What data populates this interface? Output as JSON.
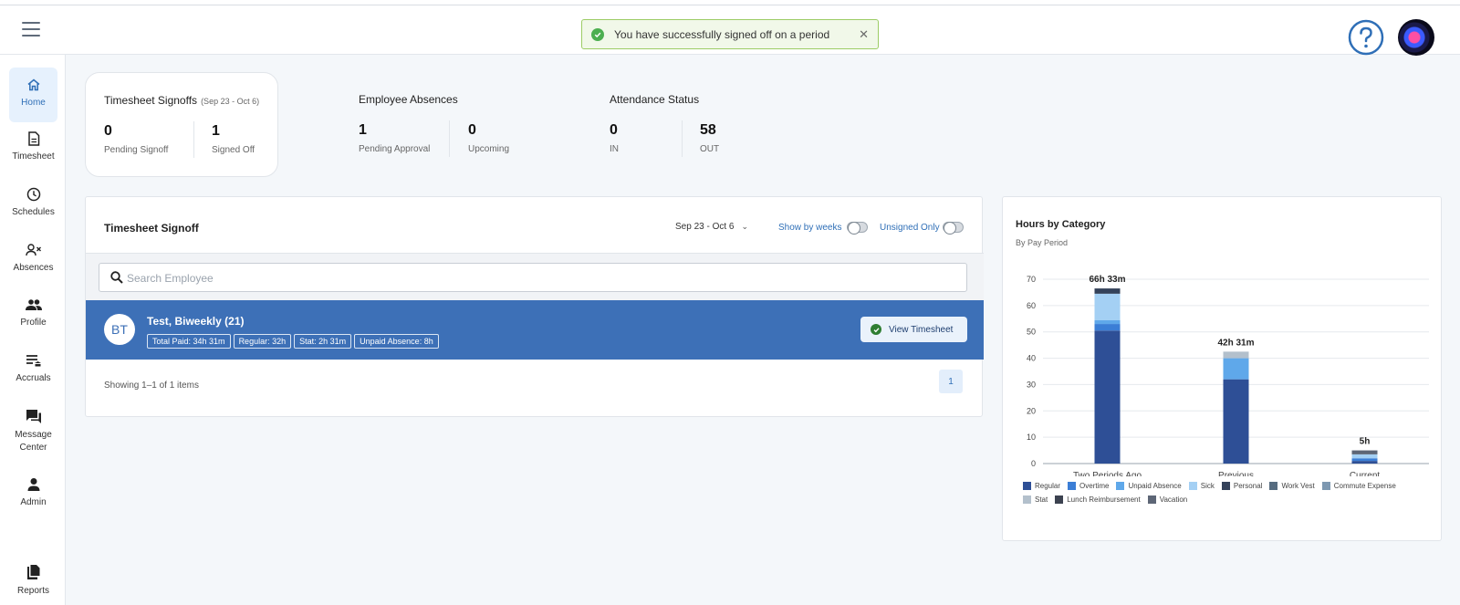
{
  "toast": {
    "message": "You have successfully signed off on a period"
  },
  "nav": {
    "items": [
      {
        "label": "Home",
        "icon": "home-icon"
      },
      {
        "label": "Timesheet",
        "icon": "document-icon"
      },
      {
        "label": "Schedules",
        "icon": "clock-icon"
      },
      {
        "label": "Absences",
        "icon": "person-remove-icon"
      },
      {
        "label": "Profile",
        "icon": "people-icon"
      },
      {
        "label": "Accruals",
        "icon": "list-bank-icon"
      },
      {
        "label": "Message Center",
        "icon": "chat-icon"
      },
      {
        "label": "Admin",
        "icon": "person-icon"
      },
      {
        "label": "Reports",
        "icon": "copy-icon"
      }
    ]
  },
  "summary": {
    "signoffs": {
      "title": "Timesheet Signoffs",
      "range": "(Sep 23 - Oct 6)",
      "pending": "0",
      "pending_label": "Pending Signoff",
      "signed": "1",
      "signed_label": "Signed Off"
    },
    "absences": {
      "title": "Employee Absences",
      "pending": "1",
      "pending_label": "Pending Approval",
      "upcoming": "0",
      "upcoming_label": "Upcoming"
    },
    "attendance": {
      "title": "Attendance Status",
      "in": "0",
      "in_label": "IN",
      "out": "58",
      "out_label": "OUT"
    }
  },
  "signoff_panel": {
    "title": "Timesheet Signoff",
    "range": "Sep 23 - Oct 6",
    "show_by_weeks": "Show by weeks",
    "unsigned_only": "Unsigned Only",
    "search_placeholder": "Search Employee",
    "employee": {
      "initials": "BT",
      "name": "Test, Biweekly (21)",
      "chips": [
        "Total Paid: 34h 31m",
        "Regular: 32h",
        "Stat: 2h 31m",
        "Unpaid Absence: 8h"
      ],
      "button": "View Timesheet"
    },
    "showing": "Showing 1–1 of 1 items",
    "page": "1"
  },
  "chart_data": {
    "type": "bar",
    "stacked": true,
    "title": "Hours by Category",
    "subtitle": "By Pay Period",
    "categories": [
      "Two Periods Ago",
      "Previous",
      "Current"
    ],
    "totals": [
      "66h 33m",
      "42h 31m",
      "5h"
    ],
    "ylim": [
      0,
      70
    ],
    "yticks": [
      0,
      10,
      20,
      30,
      40,
      50,
      60,
      70
    ],
    "grid": true,
    "legend_position": "bottom",
    "series": [
      {
        "name": "Regular",
        "color": "#2e4f96",
        "values": [
          50.5,
          32,
          1
        ]
      },
      {
        "name": "Overtime",
        "color": "#3b7ed6",
        "values": [
          2.5,
          0,
          1
        ]
      },
      {
        "name": "Unpaid Absence",
        "color": "#5fa8ea",
        "values": [
          1.5,
          8,
          0
        ]
      },
      {
        "name": "Sick",
        "color": "#a4d0f4",
        "values": [
          10,
          0,
          1.5
        ]
      },
      {
        "name": "Personal",
        "color": "#34425a",
        "values": [
          2,
          0,
          0
        ]
      },
      {
        "name": "Work Vest",
        "color": "#566c80",
        "values": [
          0,
          0,
          0
        ]
      },
      {
        "name": "Commute Expense",
        "color": "#7d98b1",
        "values": [
          0,
          0,
          0
        ]
      },
      {
        "name": "Stat",
        "color": "#b3c0cc",
        "values": [
          0,
          2.5,
          0
        ]
      },
      {
        "name": "Lunch Reimbursement",
        "color": "#3c4250",
        "values": [
          0,
          0,
          0
        ]
      },
      {
        "name": "Vacation",
        "color": "#5d6676",
        "values": [
          0,
          0,
          1.5
        ]
      }
    ]
  }
}
